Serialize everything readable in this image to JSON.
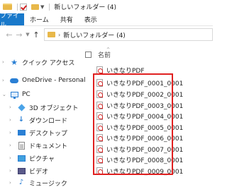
{
  "window": {
    "title": "新しいフォルダー (4)"
  },
  "ribbon": {
    "tabs": [
      "ファイル",
      "ホーム",
      "共有",
      "表示"
    ]
  },
  "address": {
    "path": "新しいフォルダー (4)"
  },
  "nav_pane": {
    "items": [
      {
        "label": "クイック アクセス",
        "icon": "star-icon"
      },
      {
        "label": "OneDrive - Personal",
        "icon": "cloud-icon"
      },
      {
        "label": "PC",
        "icon": "computer-icon"
      },
      {
        "label": "3D オブジェクト",
        "icon": "cube-icon"
      },
      {
        "label": "ダウンロード",
        "icon": "download-icon"
      },
      {
        "label": "デスクトップ",
        "icon": "desktop-icon"
      },
      {
        "label": "ドキュメント",
        "icon": "document-icon"
      },
      {
        "label": "ピクチャ",
        "icon": "picture-icon"
      },
      {
        "label": "ビデオ",
        "icon": "video-icon"
      },
      {
        "label": "ミュージック",
        "icon": "music-icon"
      }
    ]
  },
  "content": {
    "column_header": "名前",
    "files": [
      "いきなりPDF",
      "いきなりPDF_0001_0001",
      "いきなりPDF_0002_0001",
      "いきなりPDF_0003_0001",
      "いきなりPDF_0004_0001",
      "いきなりPDF_0005_0001",
      "いきなりPDF_0006_0001",
      "いきなりPDF_0007_0001",
      "いきなりPDF_0008_0001",
      "いきなりPDF_0009_0001"
    ]
  },
  "colors": {
    "accent": "#1979ca",
    "highlight": "#e02020"
  }
}
